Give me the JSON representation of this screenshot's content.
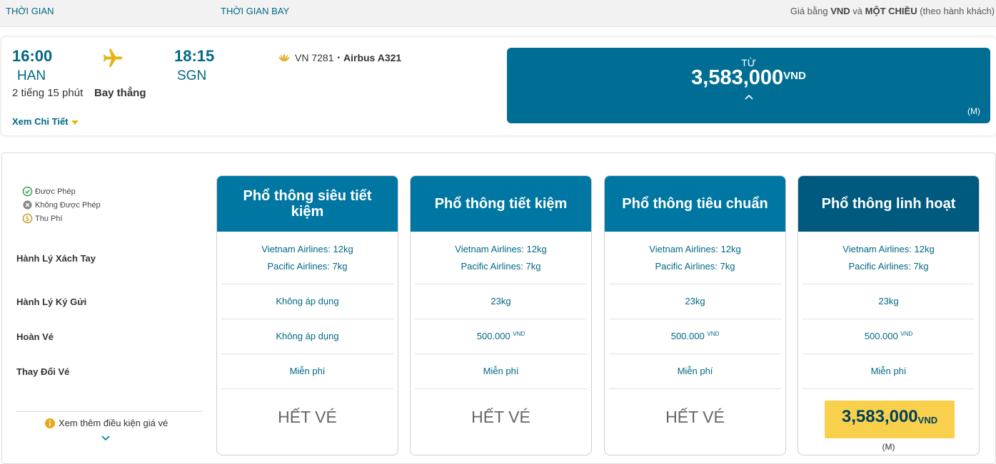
{
  "header": {
    "col_time": "THỜI GIAN",
    "col_flight_time": "THỜI GIAN BAY",
    "note_prefix": "Giá bằng ",
    "note_currency": "VND",
    "note_mid": " và ",
    "note_trip": "MỘT CHIỀU",
    "note_suffix": " (theo hành khách)"
  },
  "flight": {
    "depart_time": "16:00",
    "depart_code": "HAN",
    "arrive_time": "18:15",
    "arrive_code": "SGN",
    "duration": "2 tiếng 15 phút",
    "stops": "Bay thẳng",
    "detail_link": "Xem Chi Tiết",
    "flight_number": "VN 7281",
    "separator": "•",
    "aircraft": "Airbus A321",
    "price_from_label": "TỪ",
    "price_amount": "3,583,000",
    "price_currency": "VND",
    "price_class": "(M)"
  },
  "legend": {
    "allowed": "Được Phép",
    "not_allowed": "Không Được Phép",
    "fee": "Thu Phí"
  },
  "row_labels": {
    "carry_on": "Hành Lý Xách Tay",
    "checked": "Hành Lý Ký Gửi",
    "refund": "Hoàn Vé",
    "change": "Thay Đổi Vé"
  },
  "more_conditions": "Xem thêm điều kiện giá vé",
  "fares": [
    {
      "name": "Phổ thông siêu tiết kiệm",
      "carry_on_1": "Vietnam Airlines: 12kg",
      "carry_on_2": "Pacific Airlines: 7kg",
      "checked": "Không áp dụng",
      "refund": "Không áp dụng",
      "refund_unit": "",
      "change": "Miễn phí",
      "status": "HẾT VÉ"
    },
    {
      "name": "Phổ thông tiết kiệm",
      "carry_on_1": "Vietnam Airlines: 12kg",
      "carry_on_2": "Pacific Airlines: 7kg",
      "checked": "23kg",
      "refund": "500.000",
      "refund_unit": "VND",
      "change": "Miễn phí",
      "status": "HẾT VÉ"
    },
    {
      "name": "Phổ thông tiêu chuẩn",
      "carry_on_1": "Vietnam Airlines: 12kg",
      "carry_on_2": "Pacific Airlines: 7kg",
      "checked": "23kg",
      "refund": "500.000",
      "refund_unit": "VND",
      "change": "Miễn phí",
      "status": "HẾT VÉ"
    },
    {
      "name": "Phổ thông linh hoạt",
      "carry_on_1": "Vietnam Airlines: 12kg",
      "carry_on_2": "Pacific Airlines: 7kg",
      "checked": "23kg",
      "refund": "500.000",
      "refund_unit": "VND",
      "change": "Miễn phí",
      "price": "3,583,000",
      "price_currency": "VND",
      "price_class": "(M)"
    }
  ],
  "colors": {
    "brand_teal": "#006885",
    "price_box": "#006e94",
    "fare_header": "#0077a2",
    "fare_header_dark": "#005a7f",
    "select_button": "#f9d04b",
    "accent_gold": "#e6b313"
  }
}
